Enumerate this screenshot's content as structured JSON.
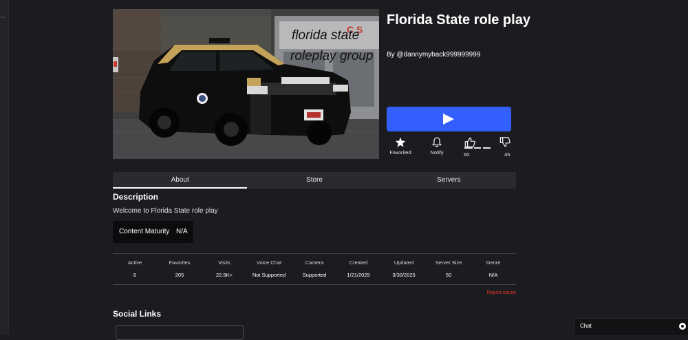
{
  "game": {
    "title": "Florida State role play",
    "creator": "By @dannymyback999999999",
    "thumbnail_text": [
      "florida state",
      "roleplay group"
    ]
  },
  "actions": {
    "play_icon": "play-icon",
    "favorite_label": "Favorited",
    "notify_label": "Notify",
    "upvotes": "60",
    "downvotes": "45"
  },
  "tabs": [
    {
      "label": "About",
      "active": true
    },
    {
      "label": "Store",
      "active": false
    },
    {
      "label": "Servers",
      "active": false
    }
  ],
  "description": {
    "heading": "Description",
    "text": "Welcome to Florida State role play"
  },
  "maturity": {
    "label": "Content Maturity",
    "value": "N/A"
  },
  "stats": [
    {
      "label": "Active",
      "value": "6"
    },
    {
      "label": "Favorites",
      "value": "205"
    },
    {
      "label": "Visits",
      "value": "22.9K+"
    },
    {
      "label": "Voice Chat",
      "value": "Not Supported"
    },
    {
      "label": "Camera",
      "value": "Supported"
    },
    {
      "label": "Created",
      "value": "1/21/2025"
    },
    {
      "label": "Updated",
      "value": "3/30/2025"
    },
    {
      "label": "Server Size",
      "value": "50"
    },
    {
      "label": "Genre",
      "value": "N/A"
    }
  ],
  "report_label": "Report Abuse",
  "social": {
    "heading": "Social Links"
  },
  "chat": {
    "label": "Chat"
  },
  "colors": {
    "background": "#1b1c20",
    "play_button": "#335fff",
    "report": "#e5322c"
  }
}
